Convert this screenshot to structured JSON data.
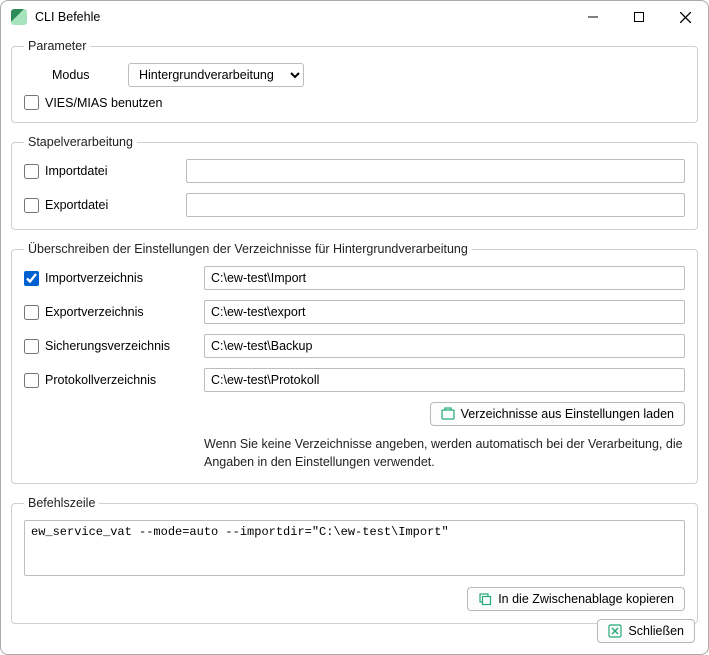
{
  "window": {
    "title": "CLI Befehle"
  },
  "parameter": {
    "legend": "Parameter",
    "modus_label": "Modus",
    "modus_value": "Hintergrundverarbeitung",
    "vies_label": "VIES/MIAS benutzen",
    "vies_checked": false
  },
  "batch": {
    "legend": "Stapelverarbeitung",
    "import_label": "Importdatei",
    "import_checked": false,
    "import_value": "",
    "export_label": "Exportdatei",
    "export_checked": false,
    "export_value": ""
  },
  "dirs": {
    "legend": "Überschreiben der Einstellungen der Verzeichnisse für Hintergrundverarbeitung",
    "import_label": "Importverzeichnis",
    "import_checked": true,
    "import_value": "C:\\ew-test\\Import",
    "export_label": "Exportverzeichnis",
    "export_checked": false,
    "export_value": "C:\\ew-test\\export",
    "backup_label": "Sicherungsverzeichnis",
    "backup_checked": false,
    "backup_value": "C:\\ew-test\\Backup",
    "log_label": "Protokollverzeichnis",
    "log_checked": false,
    "log_value": "C:\\ew-test\\Protokoll",
    "load_button": "Verzeichnisse aus Einstellungen laden",
    "hint": "Wenn Sie keine Verzeichnisse angeben, werden automatisch bei der Verarbeitung, die Angaben in den Einstellungen verwendet."
  },
  "cmd": {
    "legend": "Befehlszeile",
    "value": "ew_service_vat --mode=auto --importdir=\"C:\\ew-test\\Import\"",
    "copy_button": "In die Zwischenablage kopieren"
  },
  "footer": {
    "close": "Schließen"
  }
}
